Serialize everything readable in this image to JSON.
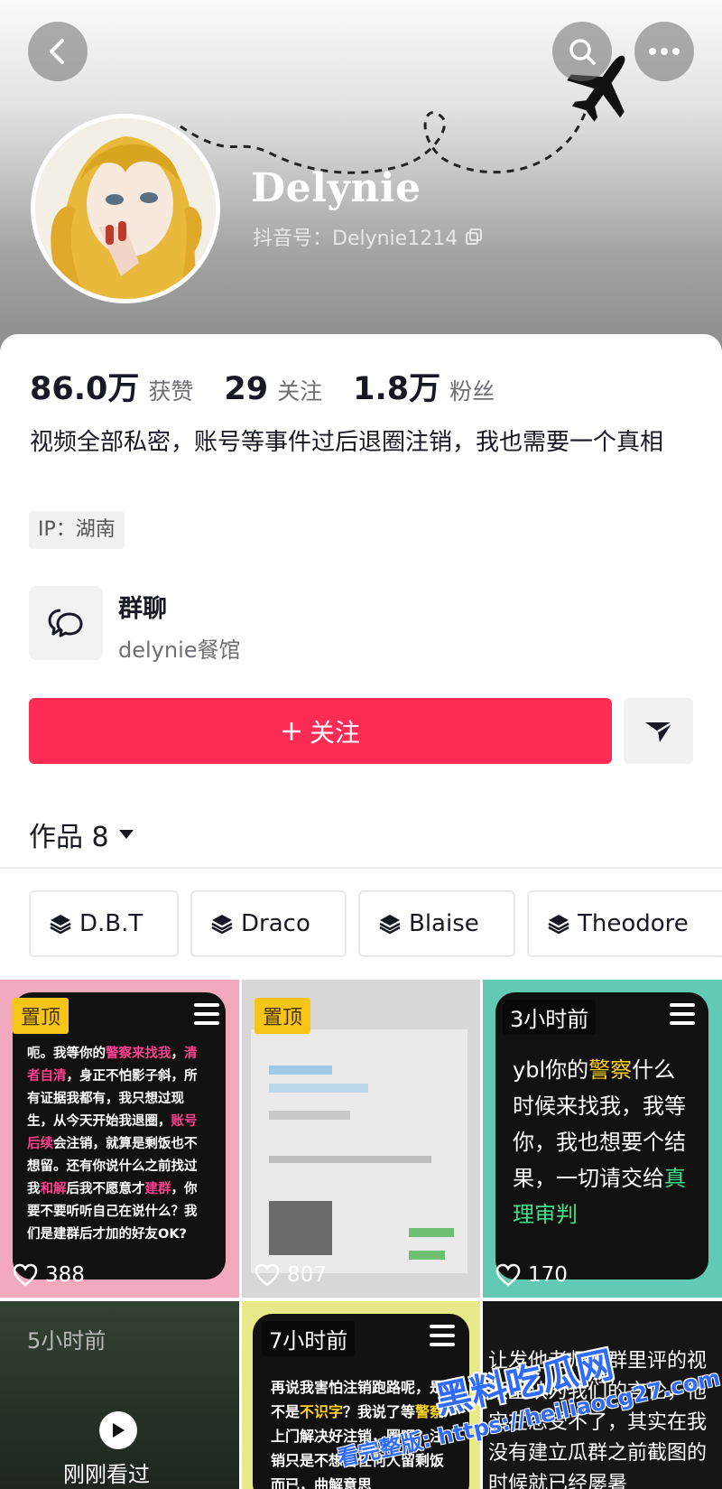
{
  "profile": {
    "nickname": "Delynie",
    "account_id": "抖音号：Delynie1214",
    "stats": [
      {
        "value": "86.0万",
        "label": "获赞"
      },
      {
        "value": "29",
        "label": "关注"
      },
      {
        "value": "1.8万",
        "label": "粉丝"
      }
    ],
    "bio": "视频全部私密，账号等事件过后退圈注销，我也需要一个真相",
    "ip": "IP：湖南"
  },
  "group_chat": {
    "title": "群聊",
    "subtitle": "delynie餐馆"
  },
  "actions": {
    "follow_label": "关注"
  },
  "works": {
    "label": "作品 8"
  },
  "collections": [
    "D.B.T",
    "Draco",
    "Blaise",
    "Theodore"
  ],
  "videos": [
    {
      "badge": "置顶",
      "likes": "388",
      "text_parts": [
        {
          "t": "呃。我等你的",
          "c": ""
        },
        {
          "t": "警察来找我",
          "c": "pink"
        },
        {
          "t": "，",
          "c": ""
        },
        {
          "t": "清者自清",
          "c": "pink"
        },
        {
          "t": "，身正不怕影子斜，所有证据我都有，我只想过现生，从今天开始我退圈，",
          "c": ""
        },
        {
          "t": "账号后续",
          "c": "pink"
        },
        {
          "t": "会注销，就算是剩饭也不想留。还有你说什么之前找过我",
          "c": ""
        },
        {
          "t": "和解",
          "c": "pink"
        },
        {
          "t": "后我不愿意才",
          "c": ""
        },
        {
          "t": "建群",
          "c": "pink"
        },
        {
          "t": "，你要不要听听自己在说什么？我们是建群后才加的好友OK?",
          "c": ""
        }
      ]
    },
    {
      "badge": "置顶",
      "likes": "807"
    },
    {
      "badge": "3小时前",
      "likes": "170",
      "text_parts": [
        {
          "t": "ybl你的",
          "c": ""
        },
        {
          "t": "警察",
          "c": "yellow"
        },
        {
          "t": "什么时候来找我，我等你，我也想要个结果，一切请交给",
          "c": ""
        },
        {
          "t": "真理审判",
          "c": "green"
        }
      ]
    },
    {
      "badge": "5小时前",
      "caption": "刚刚看过"
    },
    {
      "badge": "7小时前",
      "text_parts": [
        {
          "t": "再说我害怕注销跑路呢，是不是",
          "c": ""
        },
        {
          "t": "不识字",
          "c": "yellow"
        },
        {
          "t": "？我说了等",
          "c": ""
        },
        {
          "t": "警察",
          "c": "yellow"
        },
        {
          "t": "上门解决好注销，圈吧？注销只是不想留任何人留剩饭而已，曲解意思",
          "c": ""
        }
      ]
    },
    {
      "text": "让发他老师在群里评的视频里认为我们的言论，他实在忍受不了，其实在我没有建立瓜群之前截图的时候就已经屡暑"
    }
  ],
  "watermark": {
    "title": "黑料吃瓜网",
    "url": "看完整版: https://heiliaocg27.com"
  },
  "colors": {
    "accent": "#fe2c55",
    "highlight_pink": "#ff3f8f",
    "highlight_yellow": "#ffd21a",
    "highlight_green": "#3fe087",
    "pin_badge": "#f5c518"
  },
  "icons": [
    "back-icon",
    "search-icon",
    "more-icon",
    "airplane-icon",
    "copy-icon",
    "chat-icon",
    "plus-icon",
    "share-arrow-icon",
    "triangle-down-icon",
    "layers-icon",
    "heart-icon",
    "menu-icon",
    "play-icon"
  ]
}
